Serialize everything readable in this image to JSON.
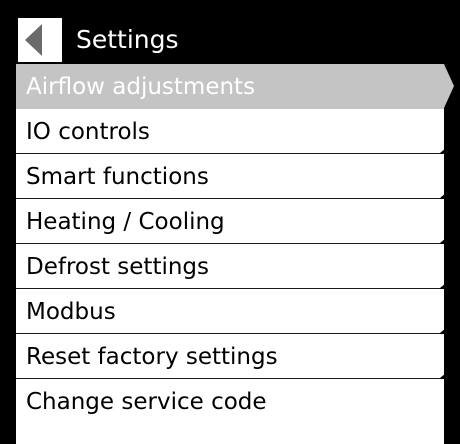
{
  "header": {
    "title": "Settings",
    "back_icon": "back-triangle-icon"
  },
  "colors": {
    "header_bg": "#000000",
    "selected_bg": "#c4c4c4",
    "item_bg": "#ffffff",
    "divider": "#1a1a1a"
  },
  "menu": {
    "selected_index": 0,
    "items": [
      {
        "label": "Airflow adjustments"
      },
      {
        "label": "IO controls"
      },
      {
        "label": "Smart functions"
      },
      {
        "label": "Heating / Cooling"
      },
      {
        "label": "Defrost settings"
      },
      {
        "label": "Modbus"
      },
      {
        "label": "Reset factory settings"
      },
      {
        "label": "Change service code"
      }
    ]
  }
}
